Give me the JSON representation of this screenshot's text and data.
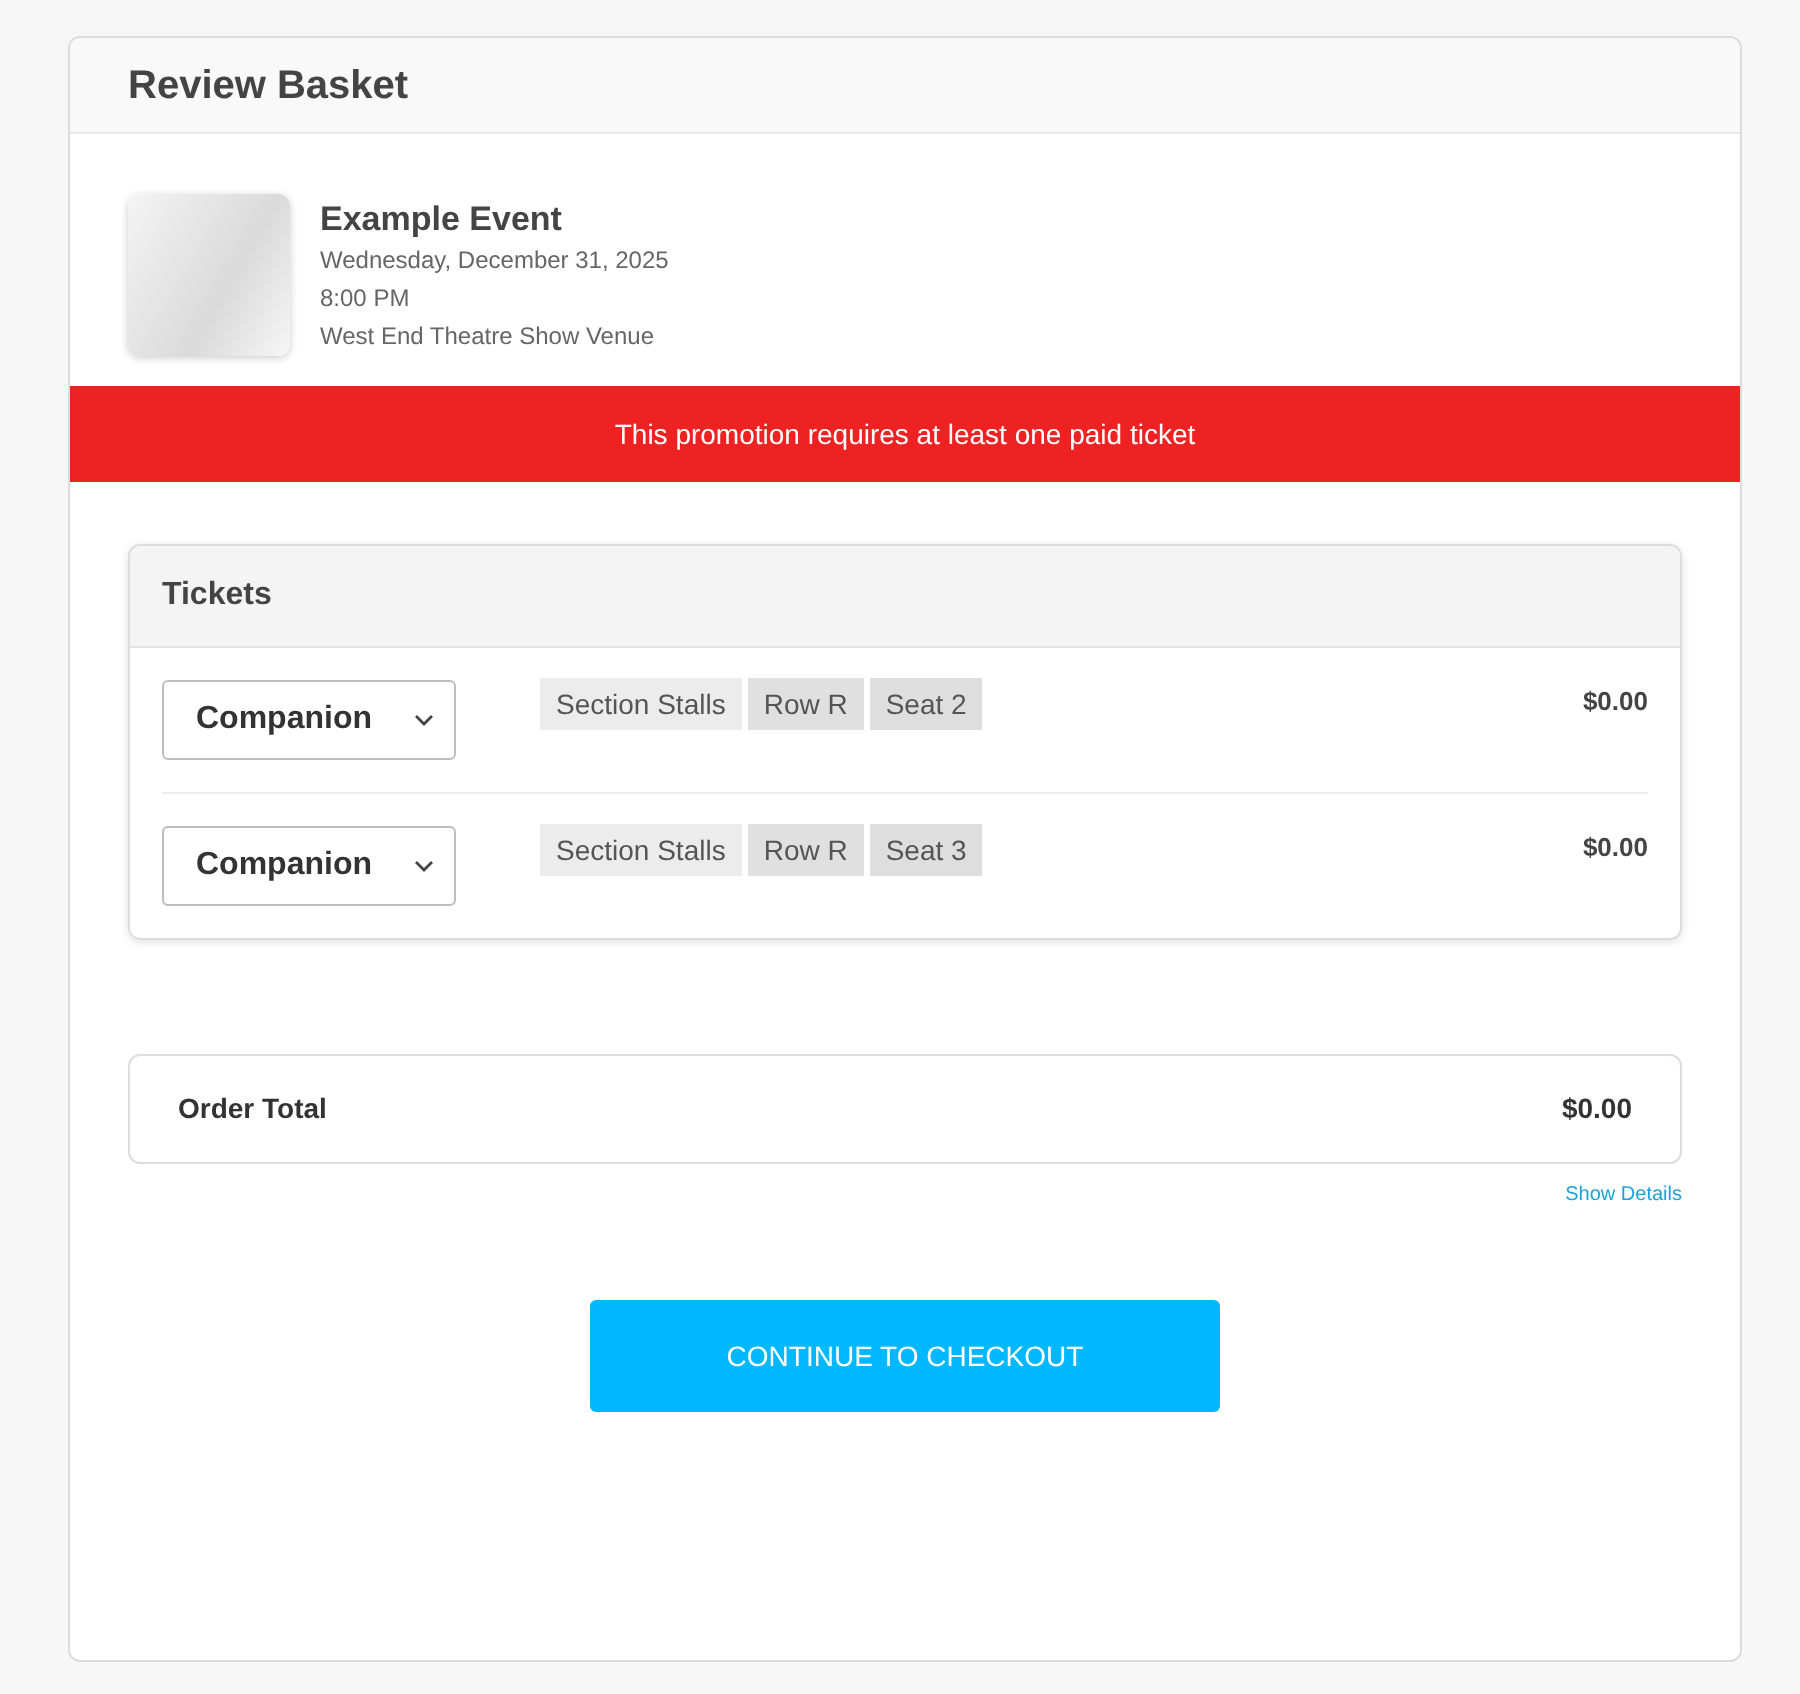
{
  "header": {
    "title": "Review Basket"
  },
  "event": {
    "title": "Example Event",
    "date": "Wednesday, December 31, 2025",
    "time": "8:00 PM",
    "venue": "West End Theatre Show Venue"
  },
  "alert": {
    "message": "This promotion requires at least one paid ticket"
  },
  "tickets": {
    "title": "Tickets",
    "items": [
      {
        "ticket_type": "Companion",
        "tags": [
          "Section Stalls",
          "Row R",
          "Seat 2"
        ],
        "price": "$0.00"
      },
      {
        "ticket_type": "Companion",
        "tags": [
          "Section Stalls",
          "Row R",
          "Seat 3"
        ],
        "price": "$0.00"
      }
    ]
  },
  "order_total": {
    "label": "Order Total",
    "amount": "$0.00",
    "details_link": "Show Details"
  },
  "checkout_button": {
    "label": "CONTINUE TO CHECKOUT"
  }
}
